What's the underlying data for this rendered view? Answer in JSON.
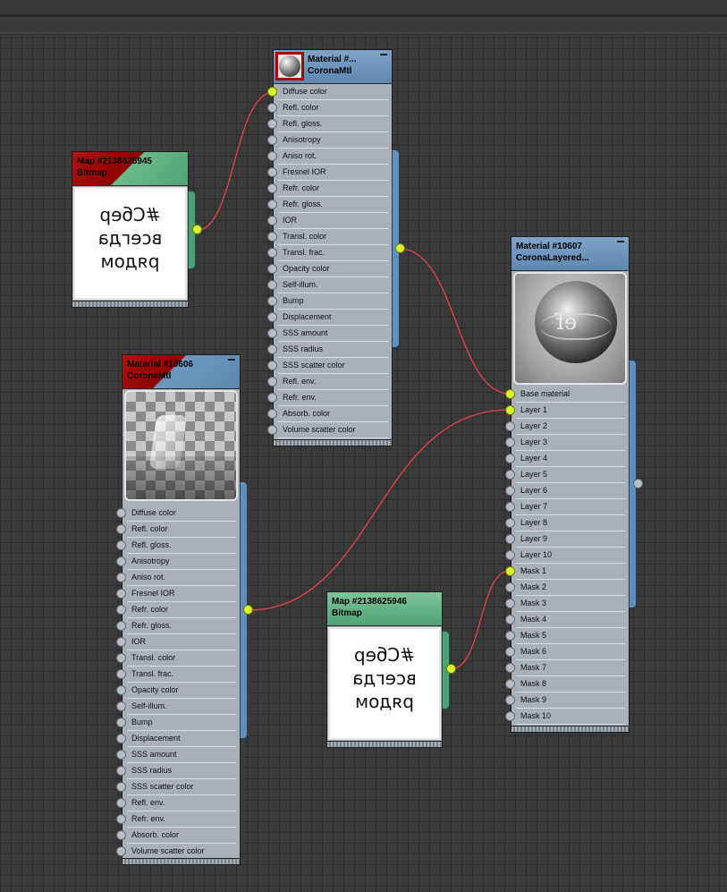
{
  "material_slots": [
    "Diffuse color",
    "Refl. color",
    "Refl. gloss.",
    "Anisotropy",
    "Aniso rot.",
    "Fresnel IOR",
    "Refr. color",
    "Refr. gloss.",
    "IOR",
    "Transl. color",
    "Transl. frac.",
    "Opacity color",
    "Self-illum.",
    "Bump",
    "Displacement",
    "SSS amount",
    "SSS radius",
    "SSS scatter color",
    "Refl. env.",
    "Refr. env.",
    "Absorb. color",
    "Volume scatter color"
  ],
  "layered_slots": [
    "Base material",
    "Layer 1",
    "Layer 2",
    "Layer 3",
    "Layer 4",
    "Layer 5",
    "Layer 6",
    "Layer 7",
    "Layer 8",
    "Layer 9",
    "Layer 10",
    "Mask 1",
    "Mask 2",
    "Mask 3",
    "Mask 4",
    "Mask 5",
    "Mask 6",
    "Mask 7",
    "Mask 8",
    "Mask 9",
    "Mask 10"
  ],
  "nodes": {
    "material_top": {
      "title": "Material #...",
      "type": "CoronaMtl",
      "connected_slots": [
        "Diffuse color"
      ]
    },
    "map_top": {
      "title": "Map #2138625945",
      "type": "Bitmap",
      "bitmap_text": [
        "#Сбер",
        "всегда",
        "рядом"
      ]
    },
    "material_left": {
      "title": "Material #10606",
      "type": "CoronaMtl",
      "connected_slots": []
    },
    "material_layered": {
      "title": "Material #10607",
      "type": "CoronaLayered...",
      "connected_slots": [
        "Base material",
        "Layer 1",
        "Mask 1"
      ]
    },
    "map_bottom": {
      "title": "Map #2138625946",
      "type": "Bitmap",
      "bitmap_text": [
        "#Сбер",
        "всегда",
        "рядом"
      ]
    }
  },
  "colors": {
    "wire": "#e8404a",
    "socket_on": "#d9f42a",
    "material_header": "#6f98c2",
    "map_header": "#5bb07e",
    "selected_corner": "#a80000"
  }
}
